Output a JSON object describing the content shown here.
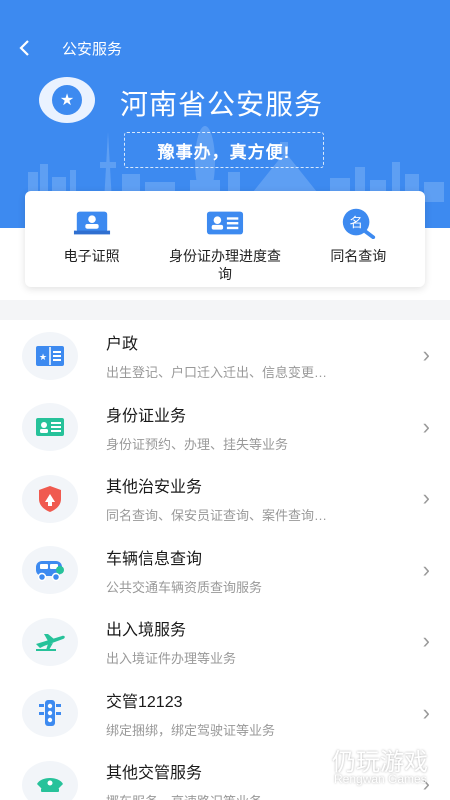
{
  "colors": {
    "primary": "#3d8af0",
    "icon_blue": "#3d8af0",
    "icon_green": "#27c29a",
    "icon_red": "#f05a4f"
  },
  "nav": {
    "back_icon": "chevron-left-icon",
    "title": "公安服务"
  },
  "hero": {
    "title": "河南省公安服务",
    "slogan": "豫事办，真方便!"
  },
  "quick": [
    {
      "label": "电子证照",
      "icon": "id-card-photo-icon"
    },
    {
      "label": "身份证办理进度查询",
      "icon": "id-card-icon"
    },
    {
      "label": "同名查询",
      "icon": "name-search-icon"
    }
  ],
  "services": [
    {
      "title": "户政",
      "subtitle": "出生登记、户口迁入迁出、信息变更…",
      "icon": "household-book-icon"
    },
    {
      "title": "身份证业务",
      "subtitle": "身份证预约、办理、挂失等业务",
      "icon": "id-card-icon"
    },
    {
      "title": "其他治安业务",
      "subtitle": "同名查询、保安员证查询、案件查询…",
      "icon": "police-shield-icon"
    },
    {
      "title": "车辆信息查询",
      "subtitle": "公共交通车辆资质查询服务",
      "icon": "car-icon"
    },
    {
      "title": "出入境服务",
      "subtitle": "出入境证件办理等业务",
      "icon": "airplane-icon"
    },
    {
      "title": "交管12123",
      "subtitle": "绑定捆绑，绑定驾驶证等业务",
      "icon": "traffic-light-icon"
    },
    {
      "title": "其他交管服务",
      "subtitle": "挪车服务、高速路况等业务",
      "icon": "police-cap-icon"
    }
  ],
  "watermark": {
    "title": "仍玩游戏",
    "subtitle": "Rengwan Games"
  }
}
